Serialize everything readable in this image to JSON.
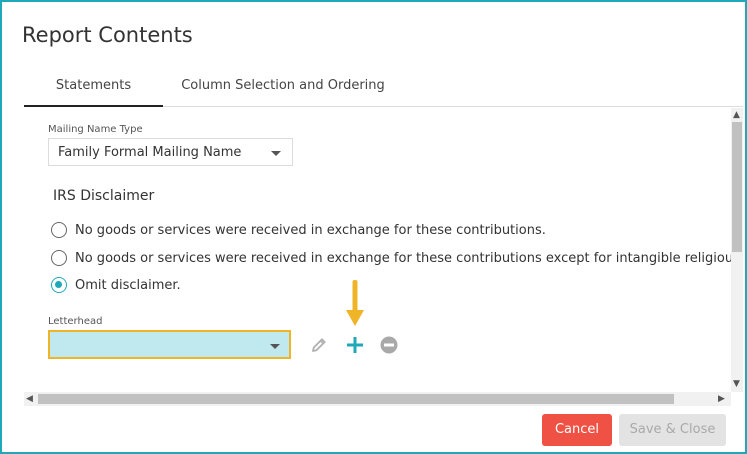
{
  "dialog": {
    "title": "Report Contents",
    "tabs": [
      {
        "label": "Statements",
        "active": true
      },
      {
        "label": "Column Selection and Ordering",
        "active": false
      }
    ]
  },
  "mailing_name_type": {
    "label": "Mailing Name Type",
    "value": "Family Formal Mailing Name"
  },
  "irs_disclaimer": {
    "heading": "IRS Disclaimer",
    "options": [
      {
        "label": "No goods or services were received in exchange for these contributions.",
        "checked": false
      },
      {
        "label": "No goods or services were received in exchange for these contributions except for intangible religious bene",
        "checked": false
      },
      {
        "label": "Omit disclaimer.",
        "checked": true
      }
    ]
  },
  "letterhead": {
    "label": "Letterhead",
    "value": "",
    "icons": [
      "pencil-icon",
      "plus-icon",
      "minus-circle-icon"
    ]
  },
  "footer": {
    "cancel_label": "Cancel",
    "save_close_label": "Save & Close"
  },
  "colors": {
    "accent": "#1fa9b8",
    "cancel": "#f05145",
    "highlight_arrow": "#f0b429",
    "letterhead_fill": "#bfe9ee",
    "letterhead_border": "#f0b429"
  },
  "scrollbar_glyphs": {
    "up": "▲",
    "down": "▼",
    "left": "◀",
    "right": "▶"
  }
}
